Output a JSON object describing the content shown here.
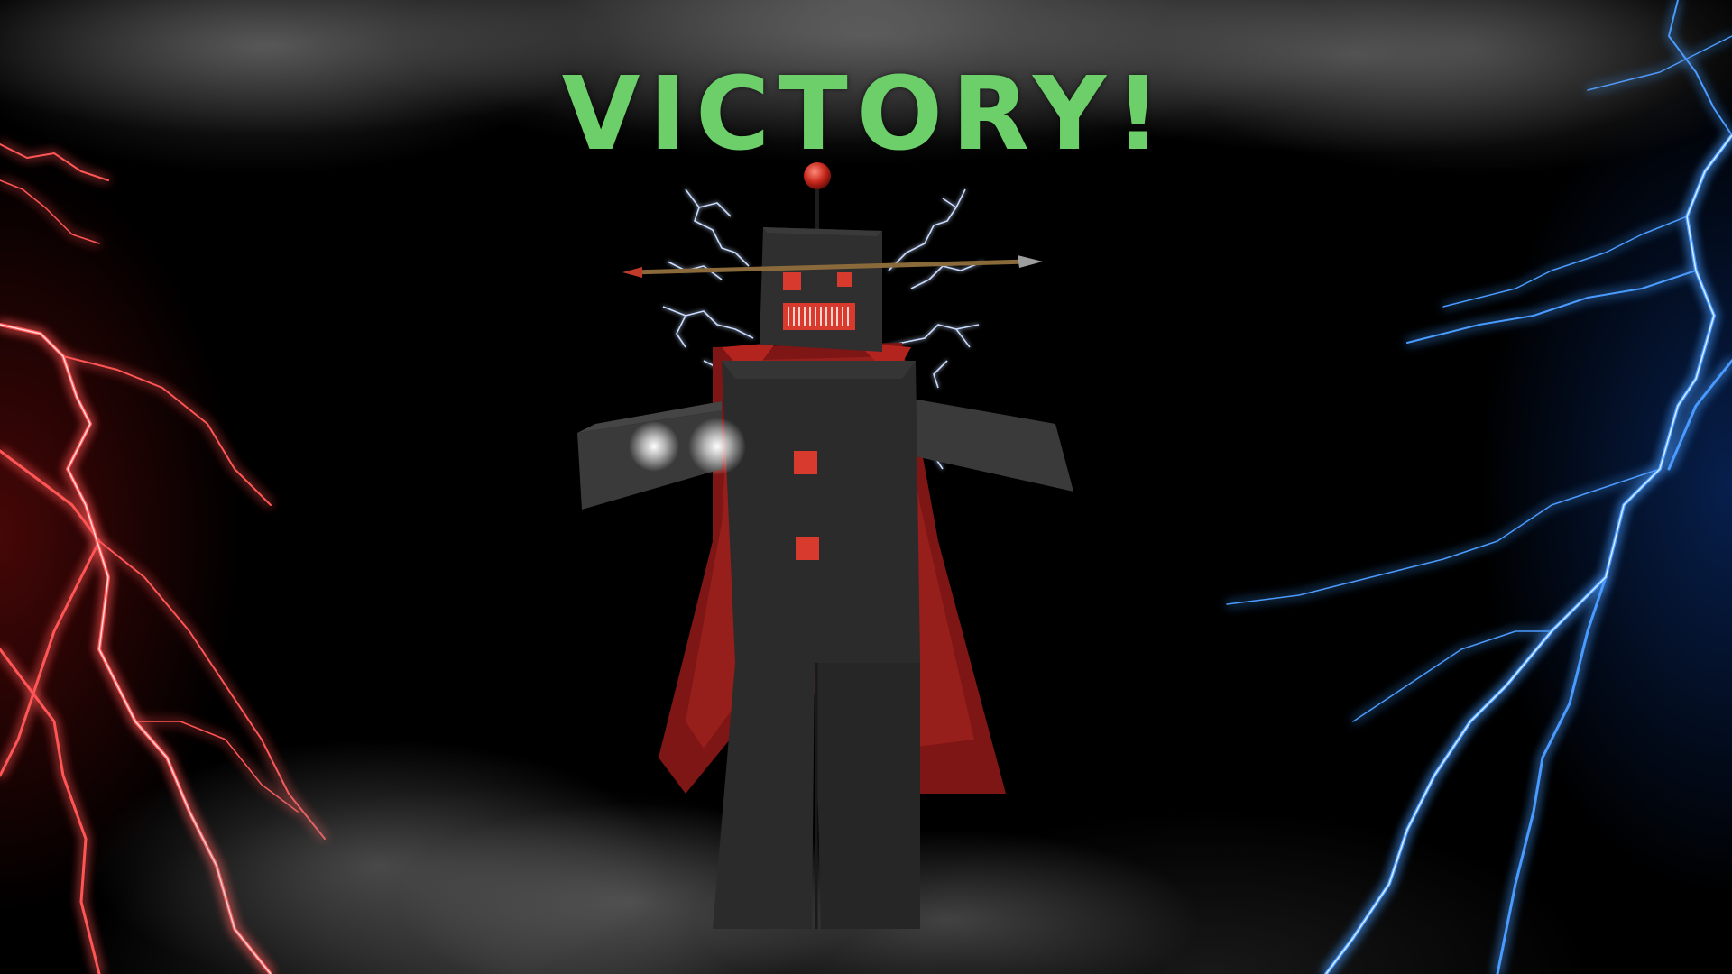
{
  "screen": {
    "title": "VICTORY!",
    "colors": {
      "title": "#6ccf6a",
      "robot_body": "#2b2b2b",
      "robot_accent": "#d93a2e",
      "cape": "#8e1a18",
      "lightning_left": "#ff3b3b",
      "lightning_right": "#3a8cff",
      "spark": "#bcd4ff"
    },
    "icons": [
      "robot-character",
      "spear",
      "red-lightning",
      "blue-lightning",
      "electric-sparks",
      "smoke"
    ]
  }
}
